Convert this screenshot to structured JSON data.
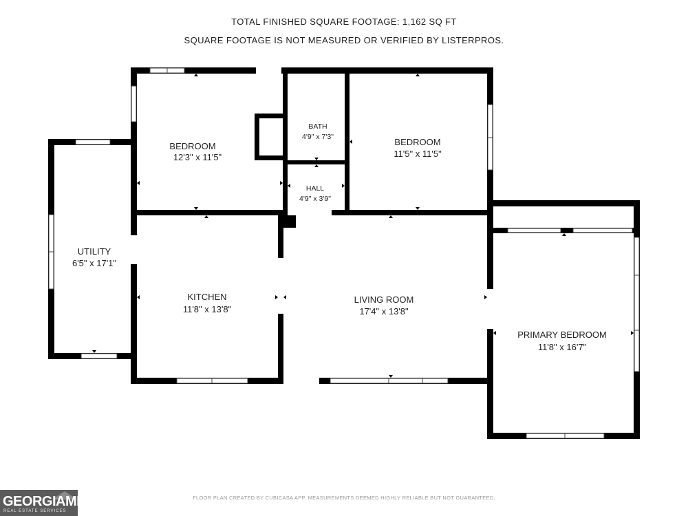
{
  "header": {
    "line1": "TOTAL FINISHED SQUARE FOOTAGE: 1,162 SQ FT",
    "line2": "SQUARE FOOTAGE IS NOT MEASURED OR VERIFIED BY LISTERPROS."
  },
  "rooms": {
    "bedroom_left": {
      "name": "BEDROOM",
      "size": "12'3\" x 11'5\""
    },
    "bath": {
      "name": "BATH",
      "size": "4'9\" x 7'3\""
    },
    "bedroom_right": {
      "name": "BEDROOM",
      "size": "11'5\" x 11'5\""
    },
    "hall": {
      "name": "HALL",
      "size": "4'9\" x 3'9\""
    },
    "utility": {
      "name": "UTILITY",
      "size": "6'5\" x 17'1\""
    },
    "kitchen": {
      "name": "KITCHEN",
      "size": "11'8\" x 13'8\""
    },
    "living_room": {
      "name": "LIVING ROOM",
      "size": "17'4\" x 13'8\""
    },
    "primary_bedroom": {
      "name": "PRIMARY BEDROOM",
      "size": "11'8\" x 16'7\""
    }
  },
  "footer": {
    "note": "FLOOR PLAN CREATED BY CUBICASA APP. MEASUREMENTS DEEMED HIGHLY RELIABLE BUT NOT GUARANTEED."
  },
  "logo": {
    "name": "GEORGIAMLS",
    "tagline": "REAL ESTATE SERVICES"
  },
  "colors": {
    "wall": "#000000",
    "window_frame": "#555555",
    "background": "#ffffff",
    "logo_bg": "#5b5b5b"
  }
}
